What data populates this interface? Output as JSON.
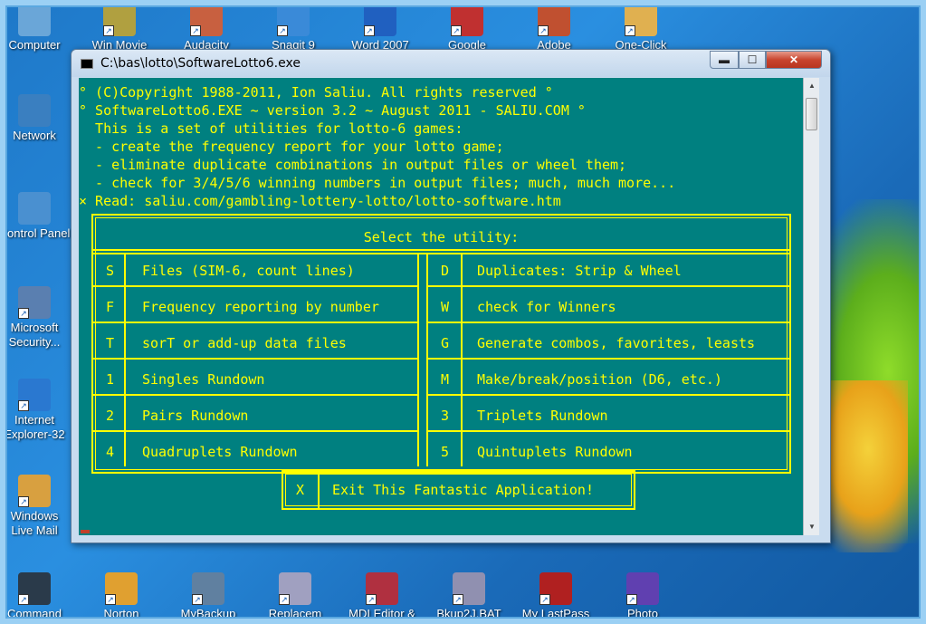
{
  "desktop": {
    "left_icons": [
      {
        "label": "Computer",
        "icon": "computer-icon"
      },
      {
        "label": "Network",
        "icon": "network-icon"
      },
      {
        "label": "Control Panel",
        "icon": "control-panel-icon"
      },
      {
        "label": "Microsoft Security...",
        "icon": "security-icon"
      },
      {
        "label": "Internet Explorer-32",
        "icon": "internet-explorer-icon"
      },
      {
        "label": "Windows Live Mail",
        "icon": "mail-icon"
      }
    ],
    "top_icons": [
      {
        "label": "Win Movie",
        "icon": "movie-icon"
      },
      {
        "label": "Audacity",
        "icon": "audacity-icon"
      },
      {
        "label": "Snagit 9",
        "icon": "snagit-icon"
      },
      {
        "label": "Word 2007",
        "icon": "word-icon"
      },
      {
        "label": "Google",
        "icon": "chrome-icon"
      },
      {
        "label": "Adobe",
        "icon": "adobe-icon"
      },
      {
        "label": "One-Click",
        "icon": "one-click-icon"
      }
    ],
    "bottom_icons": [
      {
        "label": "Command",
        "icon": "command-prompt-icon"
      },
      {
        "label": "Norton",
        "icon": "norton-icon"
      },
      {
        "label": "MyBackup",
        "icon": "backup-icon"
      },
      {
        "label": "Replacem",
        "icon": "replace-icon"
      },
      {
        "label": "MDI Editor &",
        "icon": "editor-icon"
      },
      {
        "label": "Bkup2J.BAT",
        "icon": "batch-icon"
      },
      {
        "label": "My LastPass",
        "icon": "lastpass-icon"
      },
      {
        "label": "Photo",
        "icon": "photo-icon"
      }
    ]
  },
  "window": {
    "title": "C:\\bas\\lotto\\SoftwareLotto6.exe",
    "min_label": "▬",
    "max_label": "☐",
    "close_label": "✕"
  },
  "console": {
    "header_lines": [
      "° (C)Copyright 1988-2011, Ion Saliu. All rights reserved °",
      "° SoftwareLotto6.EXE ~ version 3.2 ~ August 2011 - SALIU.COM °",
      "  This is a set of utilities for lotto-6 games:",
      "  - create the frequency report for your lotto game;",
      "  - eliminate duplicate combinations in output files or wheel them;",
      "  - check for 3/4/5/6 winning numbers in output files; much, much more...",
      "× Read: saliu.com/gambling-lottery-lotto/lotto-software.htm"
    ],
    "menu_title": "Select the utility:",
    "left_options": [
      {
        "key": "S",
        "label": "Files (SIM-6, count lines)"
      },
      {
        "key": "F",
        "label": "Frequency reporting by number"
      },
      {
        "key": "T",
        "label": "sorT or add-up data files"
      },
      {
        "key": "1",
        "label": "Singles Rundown"
      },
      {
        "key": "2",
        "label": "Pairs Rundown"
      },
      {
        "key": "4",
        "label": "Quadruplets Rundown"
      }
    ],
    "right_options": [
      {
        "key": "D",
        "label": "Duplicates: Strip & Wheel"
      },
      {
        "key": "W",
        "label": "check for Winners"
      },
      {
        "key": "G",
        "label": "Generate combos, favorites, leasts"
      },
      {
        "key": "M",
        "label": "Make/break/position (D6, etc.)"
      },
      {
        "key": "3",
        "label": "Triplets Rundown"
      },
      {
        "key": "5",
        "label": "Quintuplets Rundown"
      }
    ],
    "exit_option": {
      "key": "X",
      "label": "Exit This Fantastic Application!"
    }
  },
  "colors": {
    "console_bg": "#008080",
    "console_fg": "#ffff00",
    "close_button": "#c9452f"
  }
}
